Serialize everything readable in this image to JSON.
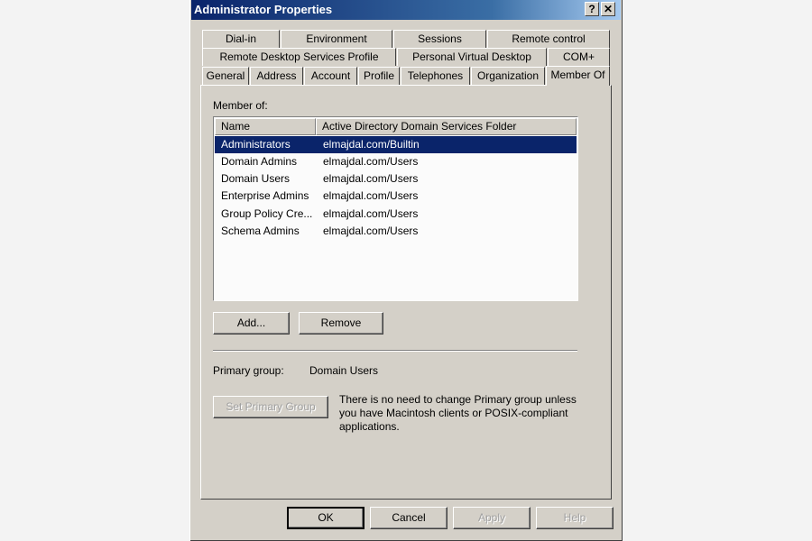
{
  "window": {
    "title": "Administrator Properties",
    "help_button": "?",
    "close_button": "✕"
  },
  "tabs": {
    "row1": [
      "Dial-in",
      "Environment",
      "Sessions",
      "Remote control"
    ],
    "row2": [
      "Remote Desktop Services Profile",
      "Personal Virtual Desktop",
      "COM+"
    ],
    "row3": [
      "General",
      "Address",
      "Account",
      "Profile",
      "Telephones",
      "Organization",
      "Member Of"
    ],
    "active": "Member Of"
  },
  "member_of": {
    "label": "Member of:",
    "columns": [
      "Name",
      "Active Directory Domain Services Folder"
    ],
    "rows": [
      {
        "name": "Administrators",
        "folder": "elmajdal.com/Builtin",
        "selected": true
      },
      {
        "name": "Domain Admins",
        "folder": "elmajdal.com/Users",
        "selected": false
      },
      {
        "name": "Domain Users",
        "folder": "elmajdal.com/Users",
        "selected": false
      },
      {
        "name": "Enterprise Admins",
        "folder": "elmajdal.com/Users",
        "selected": false
      },
      {
        "name": "Group Policy Cre...",
        "folder": "elmajdal.com/Users",
        "selected": false
      },
      {
        "name": "Schema Admins",
        "folder": "elmajdal.com/Users",
        "selected": false
      }
    ],
    "add_label": "Add...",
    "remove_label": "Remove"
  },
  "primary_group": {
    "label": "Primary group:",
    "value": "Domain Users",
    "set_button": "Set Primary Group",
    "note": "There is no need to change Primary group unless you have Macintosh clients or POSIX-compliant applications."
  },
  "footer": {
    "ok": "OK",
    "cancel": "Cancel",
    "apply": "Apply",
    "help": "Help"
  },
  "colors": {
    "selection": "#0a246a",
    "dialog_bg": "#d4d0c8",
    "title_gradient_start": "#0a246a"
  }
}
